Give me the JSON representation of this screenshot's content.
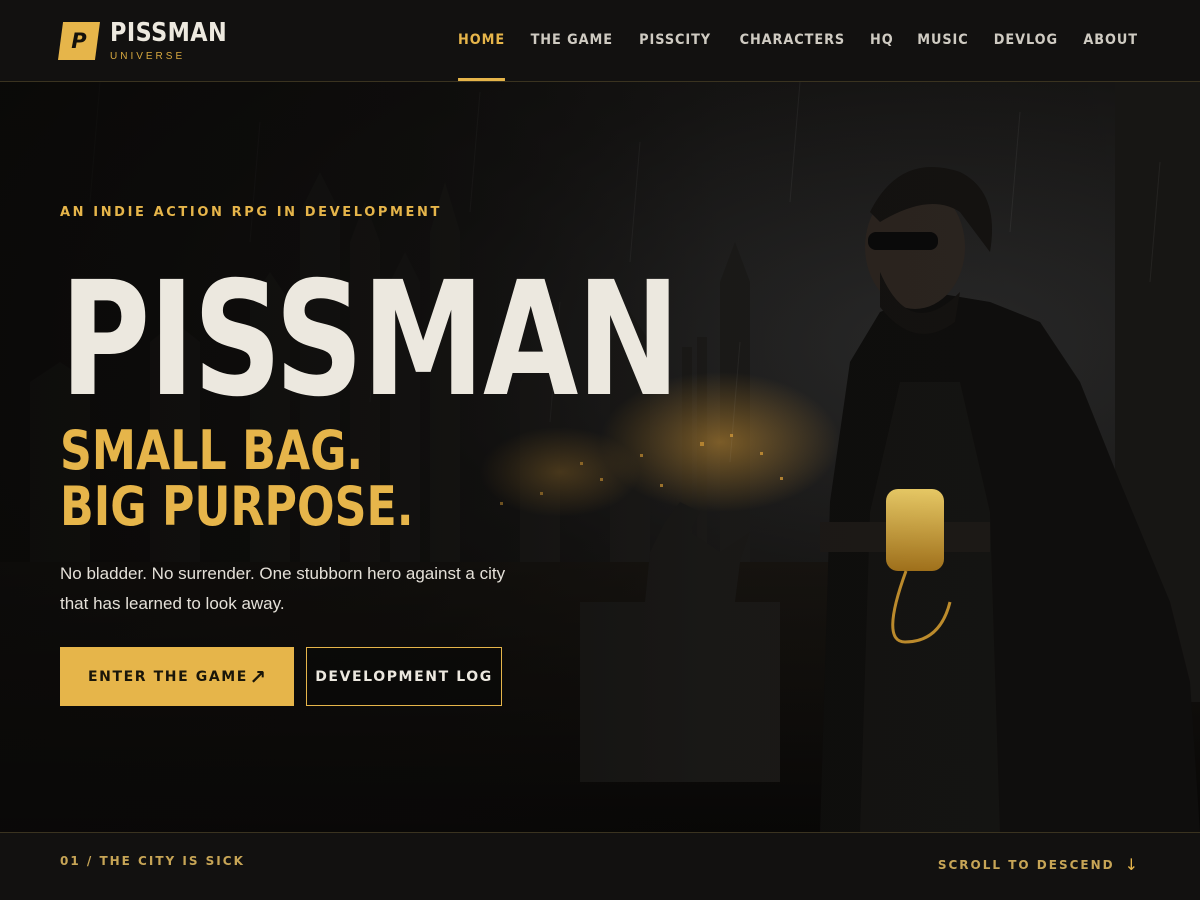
{
  "brand": {
    "mark": "P",
    "title": "PISSMAN",
    "subtitle": "UNIVERSE",
    "accent": "#e6b54a"
  },
  "nav": {
    "items": [
      {
        "label": "HOME",
        "active": true
      },
      {
        "label": "THE GAME"
      },
      {
        "label": "PISSCITY"
      },
      {
        "label": "CHARACTERS"
      },
      {
        "label": "HQ"
      },
      {
        "label": "MUSIC"
      },
      {
        "label": "DEVLOG"
      },
      {
        "label": "ABOUT"
      }
    ]
  },
  "hero": {
    "eyebrow": "AN INDIE ACTION RPG IN DEVELOPMENT",
    "title": "PISSMAN",
    "tagline_line1": "SMALL BAG.",
    "tagline_line2": "BIG PURPOSE.",
    "description": "No bladder. No surrender. One stubborn hero against a city that has learned to look away.",
    "primary_button": {
      "label": "ENTER THE GAME",
      "icon": "arrow-up-right-icon"
    },
    "secondary_button": {
      "label": "DEVELOPMENT LOG"
    }
  },
  "footer_strip": {
    "section_label": "01 / THE CITY IS SICK",
    "scroll_label": "SCROLL TO DESCEND",
    "scroll_icon": "arrow-down-icon"
  }
}
